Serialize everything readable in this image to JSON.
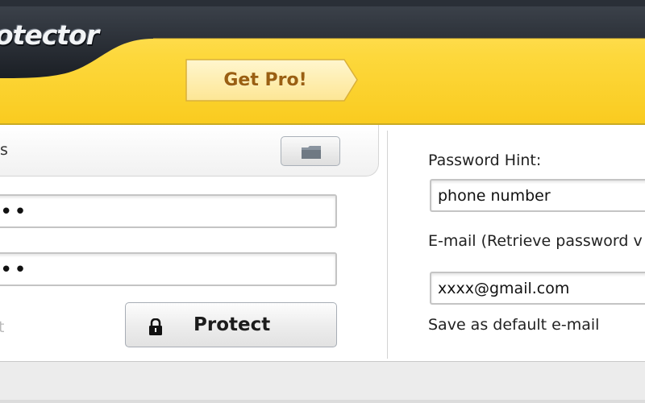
{
  "header": {
    "app_title_partial": "otector",
    "get_pro_label": "Get Pro!"
  },
  "left": {
    "file_label_partial": "s",
    "password_mask": "••",
    "confirm_mask": "••",
    "remember_partial": "t",
    "protect_label": "Protect"
  },
  "right": {
    "hint_label": "Password Hint:",
    "hint_value": "phone number",
    "email_label": "E-mail (Retrieve password v",
    "email_value": "xxxx@gmail.com",
    "save_default_label": "Save as default e-mail"
  },
  "icons": {
    "browse": "folder-icon",
    "protect": "lock-icon"
  },
  "colors": {
    "header_yellow": "#fdd83c",
    "header_dark": "#2a2f37",
    "get_pro_text": "#9a5f12"
  }
}
